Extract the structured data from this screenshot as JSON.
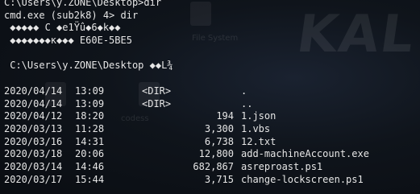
{
  "terminal": {
    "prompt1": "C:\\Users\\y.ZONE\\Desktop>dir",
    "header_line": "cmd.exe (sub2k8) 4> dir",
    "garbled1": " ◆◆◆◆◆ C ◆e1Ÿû◆6◆k◆◆",
    "garbled2": " ◆◆◆◆◆◆◆к◆◆◆ E60E-5BE5",
    "prompt2": " C:\\Users\\y.ZONE\\Desktop ◆◆L¾"
  },
  "listing": [
    {
      "date": "2020/04/14",
      "time": "13:09",
      "dir": "<DIR>",
      "size": "",
      "name": "."
    },
    {
      "date": "2020/04/14",
      "time": "13:09",
      "dir": "<DIR>",
      "size": "",
      "name": ".."
    },
    {
      "date": "2020/04/12",
      "time": "18:20",
      "dir": "",
      "size": "194",
      "name": "1.json"
    },
    {
      "date": "2020/03/13",
      "time": "11:28",
      "dir": "",
      "size": "3,300",
      "name": "1.vbs"
    },
    {
      "date": "2020/03/16",
      "time": "14:31",
      "dir": "",
      "size": "6,738",
      "name": "12.txt"
    },
    {
      "date": "2020/03/18",
      "time": "20:06",
      "dir": "",
      "size": "12,800",
      "name": "add-machineAccount.exe"
    },
    {
      "date": "2020/03/14",
      "time": "14:46",
      "dir": "",
      "size": "682,867",
      "name": "asreproast.ps1"
    },
    {
      "date": "2020/03/17",
      "time": "15:44",
      "dir": "",
      "size": "3,715",
      "name": "change-lockscreen.ps1"
    }
  ],
  "background": {
    "watermark": "KAL",
    "label_a": "File System",
    "label_b": "codess"
  },
  "colors": {
    "text": "#e6e6e6",
    "background": "#0f141b"
  }
}
